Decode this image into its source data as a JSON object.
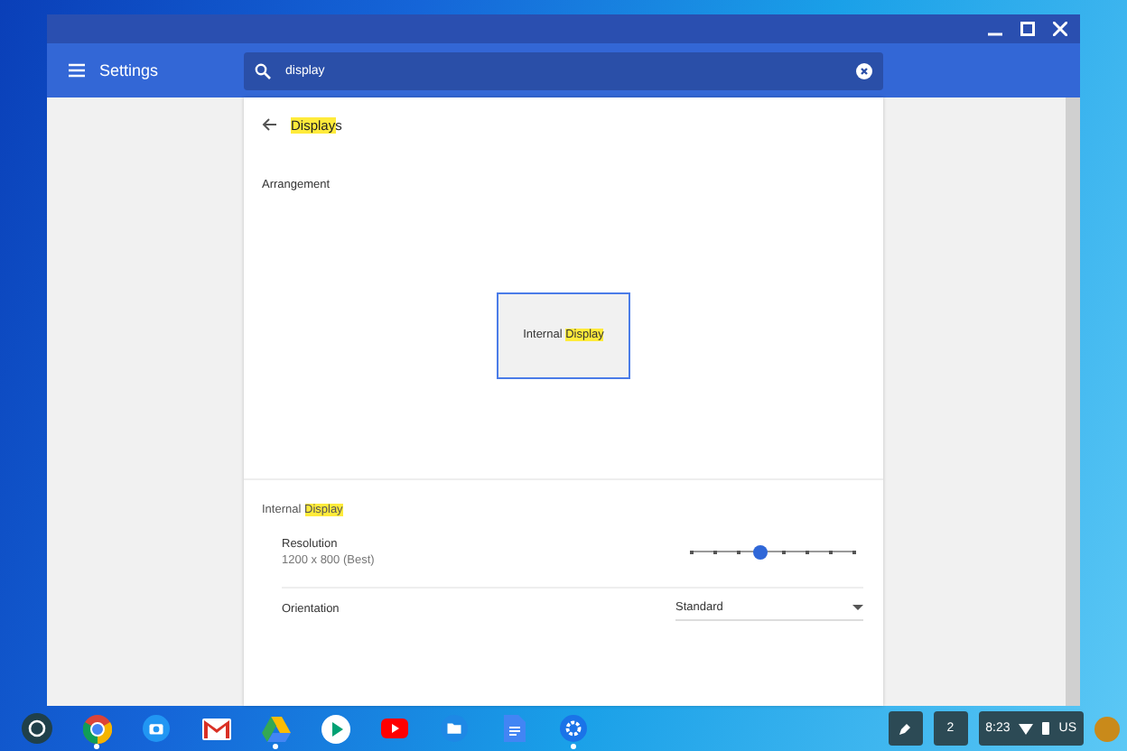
{
  "header": {
    "title": "Settings",
    "search": {
      "value": "display"
    }
  },
  "page": {
    "title": [
      {
        "text": "Display",
        "highlighted": true
      },
      {
        "text": "s",
        "highlighted": false
      }
    ],
    "arrangement": {
      "label": "Arrangement",
      "display": [
        {
          "text": "Internal ",
          "highlighted": false
        },
        {
          "text": "Display",
          "highlighted": true
        }
      ]
    },
    "section_title": [
      {
        "text": "Internal ",
        "highlighted": false
      },
      {
        "text": "Display",
        "highlighted": true
      }
    ],
    "resolution": {
      "label": "Resolution",
      "value": "1200 x 800 (Best)",
      "level": 0.43
    },
    "orientation": {
      "label": "Orientation",
      "value": "Standard"
    }
  },
  "shelf": {
    "apps": [
      {
        "kind": "chrome",
        "running": true
      },
      {
        "kind": "camera",
        "running": false
      },
      {
        "kind": "gmail",
        "running": false
      },
      {
        "kind": "drive",
        "running": true
      },
      {
        "kind": "play",
        "running": false
      },
      {
        "kind": "youtube",
        "running": false
      },
      {
        "kind": "files",
        "running": false
      },
      {
        "kind": "docs",
        "running": false
      },
      {
        "kind": "settings",
        "running": true
      }
    ],
    "notifications": "2",
    "time": "8:23",
    "locale": "US"
  }
}
